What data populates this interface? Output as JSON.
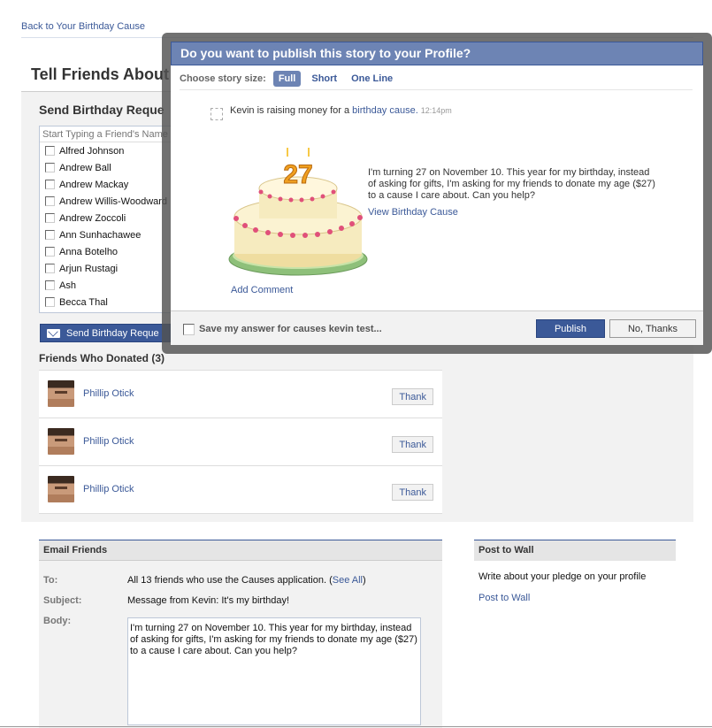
{
  "back_link": "Back to Your Birthday Cause",
  "page_title": "Tell Friends About",
  "send_requests": {
    "title": "Send Birthday Reque",
    "search_placeholder": "Start Typing a Friend's Name",
    "friends": [
      "Alfred Johnson",
      "Andrew Ball",
      "Andrew Mackay",
      "Andrew Willis-Woodward",
      "Andrew Zoccoli",
      "Ann Sunhachawee",
      "Anna Botelho",
      "Arjun Rustagi",
      "Ash",
      "Becca Thal"
    ],
    "button_label": "Send Birthday Reque"
  },
  "donated": {
    "title": "Friends Who Donated (3)",
    "donors": [
      {
        "name": "Phillip Otick",
        "thank_label": "Thank"
      },
      {
        "name": "Phillip Otick",
        "thank_label": "Thank"
      },
      {
        "name": "Phillip Otick",
        "thank_label": "Thank"
      }
    ]
  },
  "email": {
    "title": "Email Friends",
    "to_label": "To:",
    "to_value": "All 13 friends who use the Causes application. (",
    "see_all": "See All",
    "to_suffix": ")",
    "subject_label": "Subject:",
    "subject_value": "Message from Kevin: It's my birthday!",
    "body_label": "Body:",
    "body_value": "I'm turning 27 on November 10.  This year for my birthday, instead of asking for gifts, I'm asking for my friends to donate my age ($27) to a cause I care about. Can you help?"
  },
  "wall": {
    "title": "Post to Wall",
    "text": "Write about your pledge on your profile",
    "link": "Post to Wall"
  },
  "dialog": {
    "title": "Do you want to publish this story to your Profile?",
    "size_label": "Choose story size:",
    "sizes": [
      "Full",
      "Short",
      "One Line"
    ],
    "story_prefix": "Kevin is raising money for a ",
    "story_link": "birthday cause.",
    "story_time": "12:14pm",
    "cake_number": "27",
    "story_text": "I'm turning 27 on November 10. This year for my birthday, instead of asking for gifts, I'm asking for my friends to donate my age ($27) to a cause I care about. Can you help?",
    "view_cause": "View Birthday Cause",
    "add_comment": "Add Comment",
    "save_answer": "Save my answer for causes kevin test...",
    "publish": "Publish",
    "no_thanks": "No, Thanks"
  },
  "colors": {
    "brand": "#3b5998",
    "dialog_header": "#6d84b4"
  }
}
